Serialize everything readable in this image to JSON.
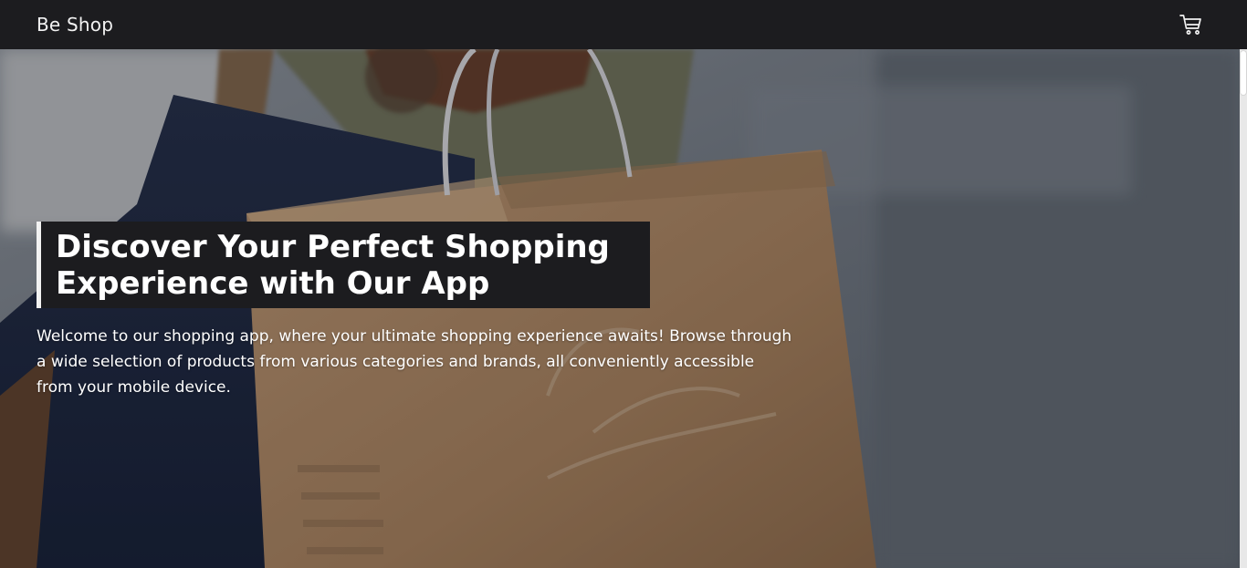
{
  "navbar": {
    "brand": "Be Shop",
    "cart_icon": "shopping-cart-icon"
  },
  "hero": {
    "headline_line1": "Discover Your Perfect Shopping",
    "headline_line2": "Experience with Our App",
    "description": "Welcome to our shopping app, where your ultimate shopping experience awaits! Browse through a wide selection of products from various categories and brands, all conveniently accessible from your mobile device.",
    "background_image": "shopping-bag-photo"
  },
  "colors": {
    "navbar_bg": "#1c1c1f",
    "text": "#ffffff",
    "headline_bg": "#1c1c1f",
    "accent_border": "#f2f2f2"
  }
}
